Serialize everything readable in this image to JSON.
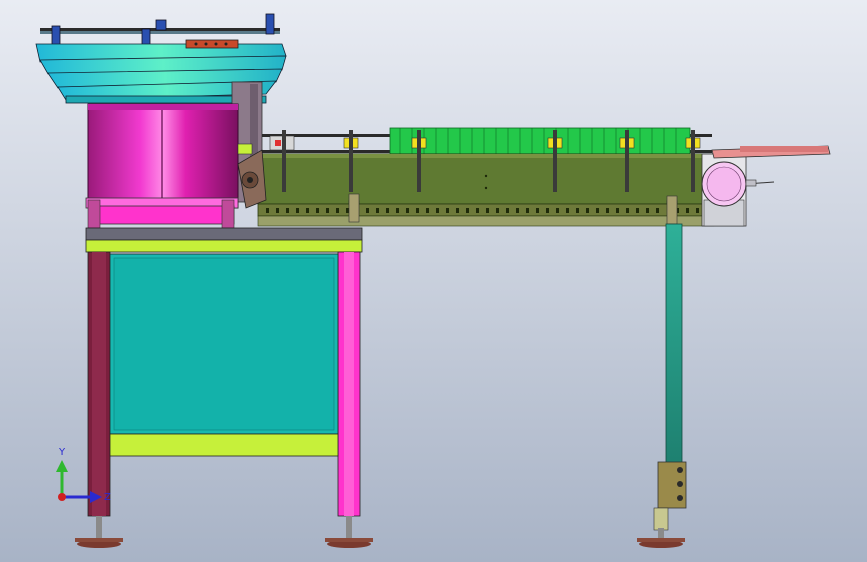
{
  "viewport": {
    "background_top": "#e8ebf2",
    "background_bottom": "#a9b4c6"
  },
  "triad": {
    "y_label": "Y",
    "z_label": "Z",
    "y_color": "#2fb82f",
    "z_color": "#2a2ad0",
    "x_color": "#d02020"
  },
  "colors": {
    "bowl_teal": "#35d6c4",
    "bowl_body_magenta": "#e020b0",
    "base_pink": "#ff33cc",
    "frame_maroon": "#7a1f3d",
    "frame_green": "#c6f03a",
    "cabinet_teal": "#17b8b0",
    "conveyor_olive": "#5f7a32",
    "rail_teal": "#2da890",
    "motor_pink": "#f7c6f2",
    "feet": "#8a4a3a"
  }
}
